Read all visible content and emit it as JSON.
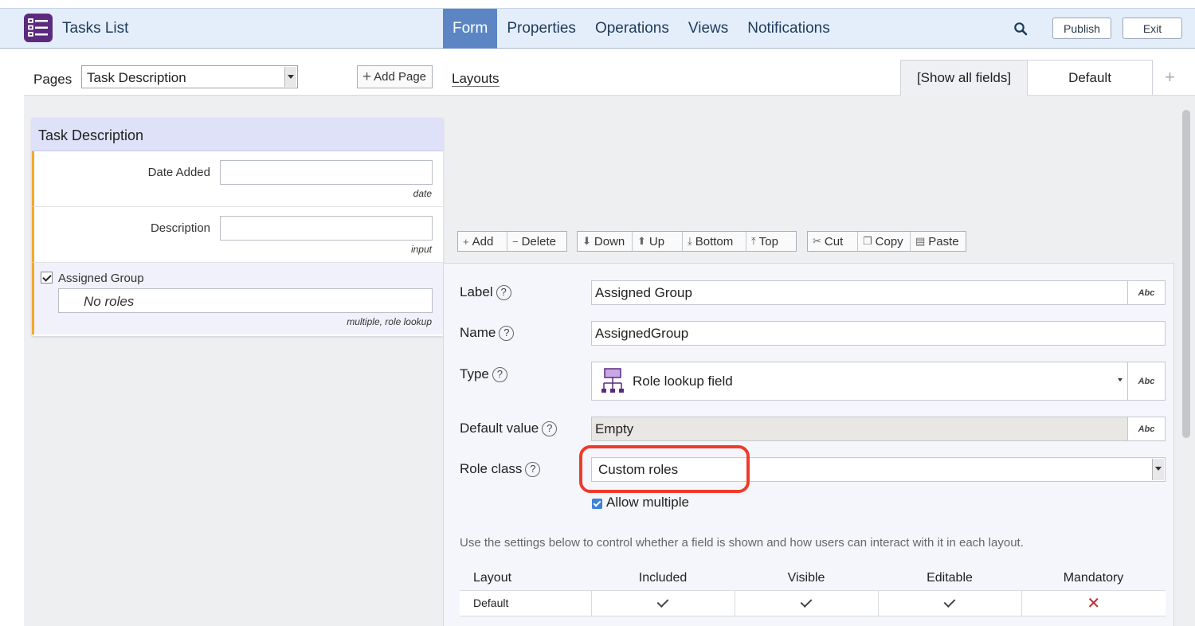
{
  "header": {
    "app_title": "Tasks List",
    "tabs": [
      {
        "label": "Form",
        "active": true
      },
      {
        "label": "Properties"
      },
      {
        "label": "Operations"
      },
      {
        "label": "Views"
      },
      {
        "label": "Notifications"
      }
    ],
    "publish_label": "Publish",
    "exit_label": "Exit"
  },
  "pages": {
    "label": "Pages",
    "selected": "Task Description",
    "add_page_label": "Add Page"
  },
  "layouts": {
    "label": "Layouts",
    "tabs": [
      {
        "label": "[Show all fields]",
        "active": true
      },
      {
        "label": "Default"
      }
    ]
  },
  "form_card": {
    "title": "Task Description",
    "fields": [
      {
        "label": "Date Added",
        "type": "date"
      },
      {
        "label": "Description",
        "type": "input"
      }
    ],
    "selected_field": {
      "label": "Assigned Group",
      "value": "No roles",
      "type": "multiple, role lookup"
    }
  },
  "toolbar": {
    "add": "Add",
    "delete": "Delete",
    "down": "Down",
    "up": "Up",
    "bottom": "Bottom",
    "top": "Top",
    "cut": "Cut",
    "copy": "Copy",
    "paste": "Paste"
  },
  "properties": {
    "label_field": {
      "label": "Label",
      "value": "Assigned Group"
    },
    "name_field": {
      "label": "Name",
      "value": "AssignedGroup"
    },
    "type_field": {
      "label": "Type",
      "value": "Role lookup field"
    },
    "default_field": {
      "label": "Default value",
      "value": "Empty"
    },
    "role_class_field": {
      "label": "Role class",
      "value": "Custom roles"
    },
    "allow_multiple": {
      "label": "Allow multiple",
      "checked": true
    },
    "abc_label": "Abc",
    "hint": "Use the settings below to control whether a field is shown and how users can interact with it in each layout."
  },
  "permissions": {
    "headers": [
      "Layout",
      "Included",
      "Visible",
      "Editable",
      "Mandatory"
    ],
    "rows": [
      {
        "layout": "Default",
        "included": true,
        "visible": true,
        "editable": true,
        "mandatory": false
      }
    ]
  },
  "colors": {
    "accent": "#5c86c3",
    "app_icon": "#5b2a7e",
    "highlight": "#ef3b2c",
    "field_marker": "#f3a92a"
  }
}
